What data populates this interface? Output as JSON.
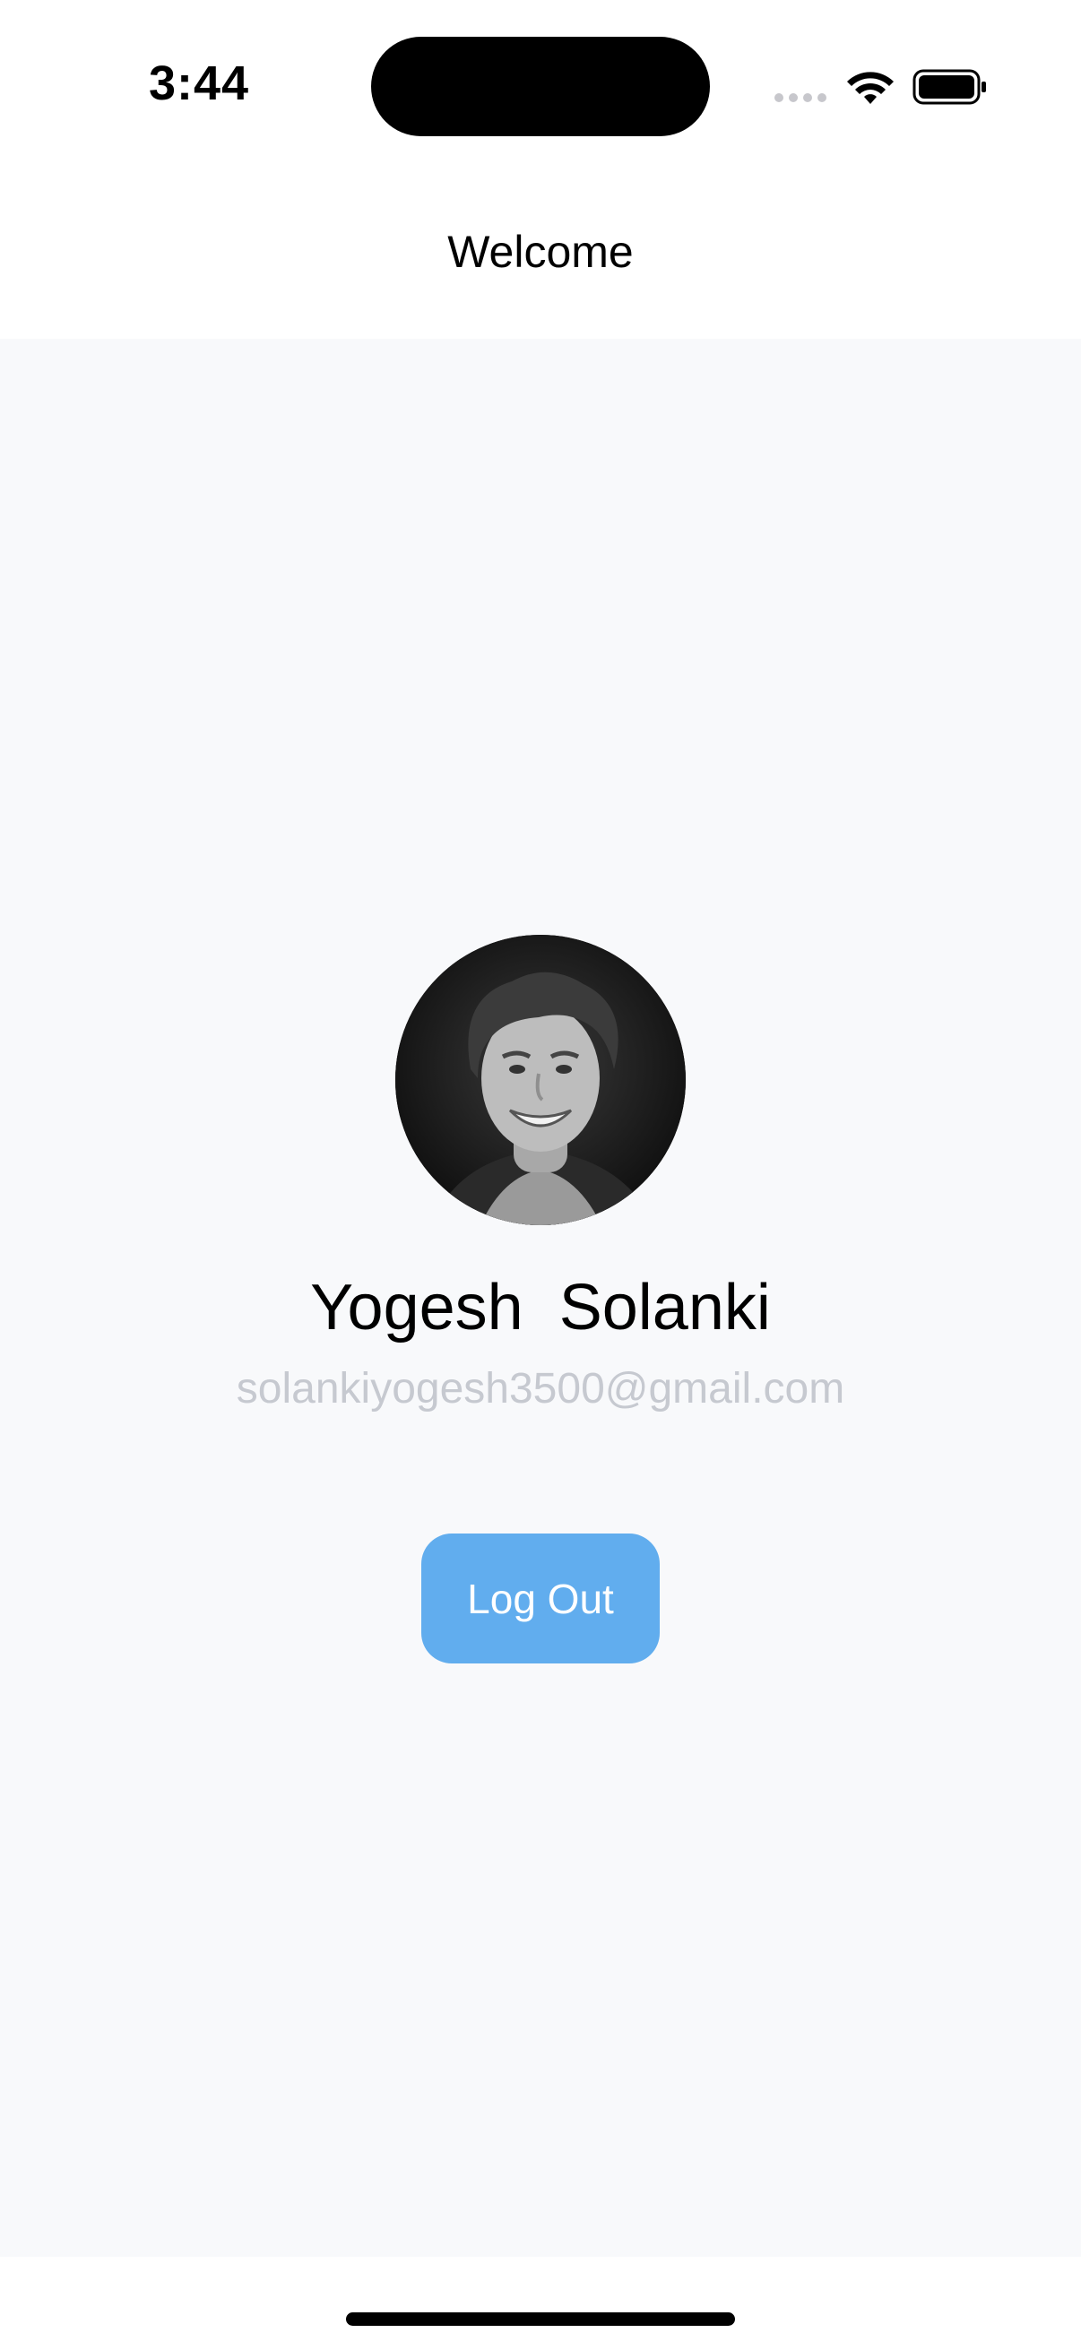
{
  "status_bar": {
    "time": "3:44"
  },
  "nav": {
    "title": "Welcome"
  },
  "profile": {
    "name": "Yogesh  Solanki",
    "email": "solankiyogesh3500@gmail.com",
    "avatar_icon": "profile-photo"
  },
  "actions": {
    "logout_label": "Log Out"
  },
  "colors": {
    "accent": "#61adee",
    "email_text": "#c6c9d0",
    "background": "#f8f9fb"
  }
}
